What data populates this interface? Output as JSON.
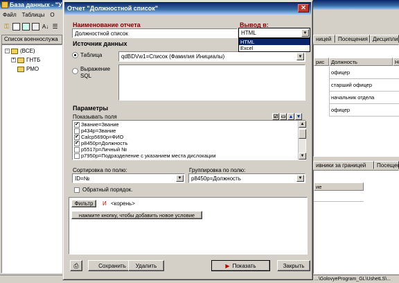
{
  "main_window": {
    "title": "База данных - \"У",
    "menu": [
      "Файл",
      "Таблицы",
      "О"
    ],
    "tree_header": "Список военнослужа",
    "tree_items": [
      "(ВСЕ)",
      "ГНТБ",
      "РМО"
    ],
    "right_tabs_top": [
      "ницей",
      "Посещения",
      "Дисциплин"
    ],
    "grid_headers": [
      "рис",
      "Должность",
      "Но"
    ],
    "grid_rows": [
      "офицер",
      "старший офицер",
      "начальник отдела",
      "офицер"
    ],
    "right_tabs_bottom": [
      "ивники за границей",
      "Посещен"
    ],
    "lower_grid_header": "ие",
    "status_path": "...\\GolovyeProgram_GL\\UshetLS\\..."
  },
  "dialog": {
    "title": "Отчет \"Должностной список\"",
    "report_name_label": "Наименование отчета",
    "report_name_value": "Должностной список",
    "output_label": "Вывод в:",
    "output_selected": "HTML",
    "output_options": [
      "HTML",
      "Excel"
    ],
    "data_source_label": "Источник данных",
    "radio_table_label": "Таблица",
    "table_value": "qdBDVw1=Список (Фамилия Инициалы)",
    "radio_sql_label": "Выражение SQL",
    "params_label": "Параметры",
    "show_fields_label": "Показывать поля",
    "fields": [
      {
        "text": "Звание=Звание",
        "checked": true
      },
      {
        "text": "p434p=Звание",
        "checked": false
      },
      {
        "text": "Calcp5690p=ФИО",
        "checked": true
      },
      {
        "text": "p8450p=Должность",
        "checked": true
      },
      {
        "text": "p5517p=Личный №",
        "checked": false
      },
      {
        "text": "p7950p=Подразделение с указанием места дислокации",
        "checked": false
      }
    ],
    "sort_label": "Сортировка по полю:",
    "sort_value": "ID=№",
    "group_label": "Группировка по полю:",
    "group_value": "p8450p=Должность",
    "reverse_order_label": "Обратный порядок.",
    "filter_button": "Фильтр",
    "filter_and": "И",
    "filter_root": "<корень>",
    "filter_add_condition": "нажмите кнопку, чтобы добавить новое условие",
    "save_button": "Сохранить",
    "delete_button": "Удалить",
    "show_button": "Показать",
    "close_button": "Закрыть"
  },
  "colors": {
    "titlebar_start": "#0a246a",
    "titlebar_end": "#a6caf0",
    "face": "#d4d0c8",
    "dark_red_label": "#800000",
    "highlight": "#0a246a"
  }
}
